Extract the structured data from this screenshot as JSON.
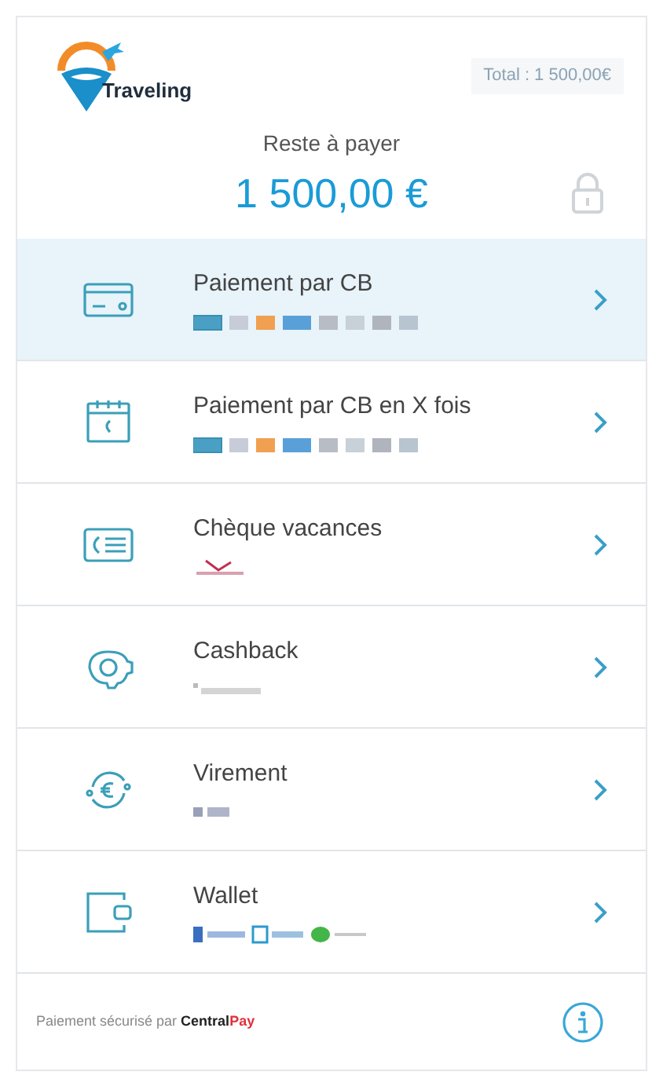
{
  "header": {
    "logo_text": "Traveling",
    "total": "Total : 1 500,00€",
    "remaining_label": "Reste à payer",
    "remaining_amount": "1 500,00 €"
  },
  "methods": [
    {
      "label": "Paiement par CB",
      "kind": "card",
      "selected": true
    },
    {
      "label": "Paiement par CB en X fois",
      "kind": "instalments",
      "selected": false
    },
    {
      "label": "Chèque vacances",
      "kind": "voucher",
      "selected": false
    },
    {
      "label": "Cashback",
      "kind": "cashback",
      "selected": false
    },
    {
      "label": "Virement",
      "kind": "transfer",
      "selected": false
    },
    {
      "label": "Wallet",
      "kind": "wallet",
      "selected": false
    }
  ],
  "footer": {
    "text": "Paiement sécurisé par",
    "brand_main": "Central",
    "brand_accent": "Pay"
  }
}
